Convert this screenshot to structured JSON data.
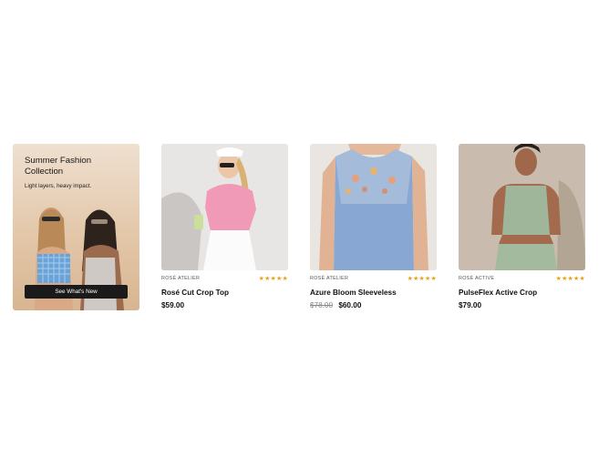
{
  "promo": {
    "title": "Summer Fashion Collection",
    "subtitle": "Light layers, heavy impact.",
    "button_label": "See What's New"
  },
  "products": [
    {
      "brand": "ROSÉ ATELIER",
      "name": "Rosé Cut Crop Top",
      "old_price": "",
      "price": "$59.00",
      "rating": 5,
      "stars": "★★★★★"
    },
    {
      "brand": "ROSÉ ATELIER",
      "name": "Azure Bloom Sleeveless",
      "old_price": "$78.00",
      "price": "$60.00",
      "rating": 5,
      "stars": "★★★★★"
    },
    {
      "brand": "ROSÉ ACTIVE",
      "name": "PulseFlex Active Crop",
      "old_price": "",
      "price": "$79.00",
      "rating": 5,
      "stars": "★★★★★"
    }
  ],
  "colors": {
    "star": "#e9a21b",
    "button_bg": "#1a1a1a"
  }
}
